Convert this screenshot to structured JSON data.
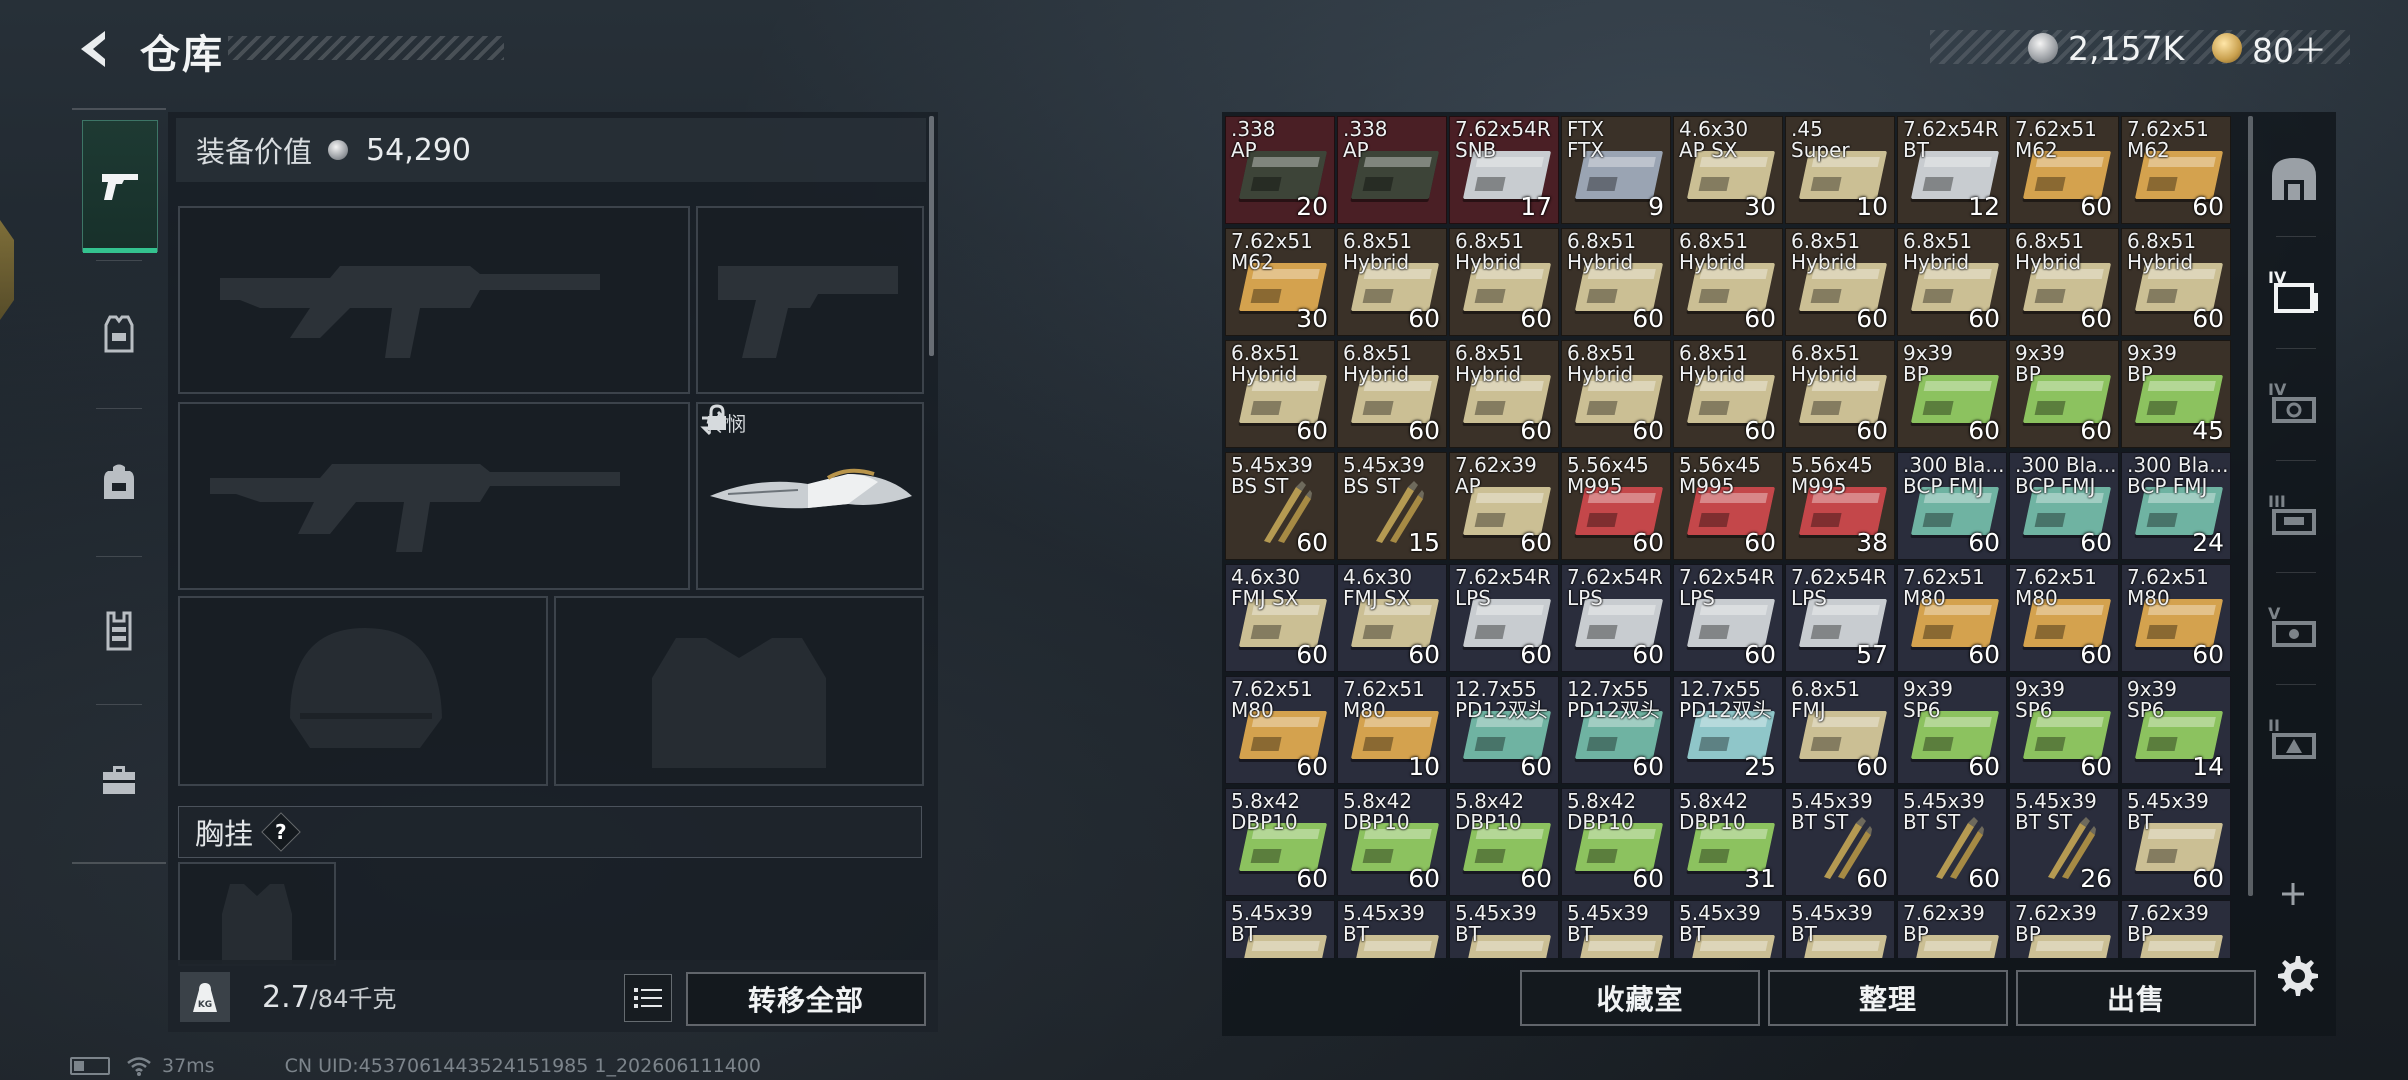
{
  "header": {
    "title": "仓库",
    "currency_silver": "2,157K",
    "currency_gold": "80＋"
  },
  "loadout": {
    "gear_value_label": "装备价值",
    "gear_value": "54,290",
    "melee_name": "怜悯",
    "chest_rig_label": "胸挂",
    "help_glyph": "?",
    "weight_value": "2.7",
    "weight_capacity": "/84千克",
    "transfer_all_label": "转移全部",
    "weight_icon_label": "KG"
  },
  "bottom_buttons": {
    "collection_room": "收藏室",
    "organize": "整理",
    "sell": "出售"
  },
  "status": {
    "ping": "37ms",
    "uid": "CN UID:4537061443524151985 1_202606111400"
  },
  "grid": {
    "rows": [
      [
        {
          "name": ".338\nAP",
          "count": "20",
          "bg": "#4a1f25",
          "box": "dark"
        },
        {
          "name": ".338\nAP",
          "count": "",
          "bg": "#4a1f25",
          "box": "dark"
        },
        {
          "name": "7.62x54R\nSNB",
          "count": "17",
          "bg": "#4a1f25",
          "box": "silver"
        },
        {
          "name": "FTX\nFTX",
          "count": "9",
          "bg": "#3a3128",
          "box": "steel"
        },
        {
          "name": "4.6x30\nAP SX",
          "count": "30",
          "bg": "#3a3128",
          "box": "beige"
        },
        {
          "name": ".45\nSuper",
          "count": "10",
          "bg": "#3a3128",
          "box": "beige"
        },
        {
          "name": "7.62x54R\nBT",
          "count": "12",
          "bg": "#3a3128",
          "box": "silver"
        },
        {
          "name": "7.62x51\nM62",
          "count": "60",
          "bg": "#3a3128",
          "box": "tan"
        },
        {
          "name": "7.62x51\nM62",
          "count": "60",
          "bg": "#3a3128",
          "box": "tan"
        }
      ],
      [
        {
          "name": "7.62x51\nM62",
          "count": "30",
          "bg": "#3a3128",
          "box": "tan"
        },
        {
          "name": "6.8x51\nHybrid",
          "count": "60",
          "bg": "#3a3128",
          "box": "beige"
        },
        {
          "name": "6.8x51\nHybrid",
          "count": "60",
          "bg": "#3a3128",
          "box": "beige"
        },
        {
          "name": "6.8x51\nHybrid",
          "count": "60",
          "bg": "#3a3128",
          "box": "beige"
        },
        {
          "name": "6.8x51\nHybrid",
          "count": "60",
          "bg": "#3a3128",
          "box": "beige"
        },
        {
          "name": "6.8x51\nHybrid",
          "count": "60",
          "bg": "#3a3128",
          "box": "beige"
        },
        {
          "name": "6.8x51\nHybrid",
          "count": "60",
          "bg": "#3a3128",
          "box": "beige"
        },
        {
          "name": "6.8x51\nHybrid",
          "count": "60",
          "bg": "#3a3128",
          "box": "beige"
        },
        {
          "name": "6.8x51\nHybrid",
          "count": "60",
          "bg": "#3a3128",
          "box": "beige"
        }
      ],
      [
        {
          "name": "6.8x51\nHybrid",
          "count": "60",
          "bg": "#3a3128",
          "box": "beige"
        },
        {
          "name": "6.8x51\nHybrid",
          "count": "60",
          "bg": "#3a3128",
          "box": "beige"
        },
        {
          "name": "6.8x51\nHybrid",
          "count": "60",
          "bg": "#3a3128",
          "box": "beige"
        },
        {
          "name": "6.8x51\nHybrid",
          "count": "60",
          "bg": "#3a3128",
          "box": "beige"
        },
        {
          "name": "6.8x51\nHybrid",
          "count": "60",
          "bg": "#3a3128",
          "box": "beige"
        },
        {
          "name": "6.8x51\nHybrid",
          "count": "60",
          "bg": "#3a3128",
          "box": "beige"
        },
        {
          "name": "9x39\nBP",
          "count": "60",
          "bg": "#3a3128",
          "box": "green"
        },
        {
          "name": "9x39\nBP",
          "count": "60",
          "bg": "#3a3128",
          "box": "green"
        },
        {
          "name": "9x39\nBP",
          "count": "45",
          "bg": "#3a3128",
          "box": "green"
        }
      ],
      [
        {
          "name": "5.45x39\nBS ST",
          "count": "60",
          "bg": "#3a3128",
          "box": "shells"
        },
        {
          "name": "5.45x39\nBS ST",
          "count": "15",
          "bg": "#3a3128",
          "box": "shells"
        },
        {
          "name": "7.62x39\nAP",
          "count": "60",
          "bg": "#3a3128",
          "box": "beige"
        },
        {
          "name": "5.56x45\nM995",
          "count": "60",
          "bg": "#3a3128",
          "box": "red"
        },
        {
          "name": "5.56x45\nM995",
          "count": "60",
          "bg": "#3a3128",
          "box": "red"
        },
        {
          "name": "5.56x45\nM995",
          "count": "38",
          "bg": "#3a3128",
          "box": "red"
        },
        {
          "name": ".300 Bla...\nBCP FMJ",
          "count": "60",
          "bg": "#2a2d3c",
          "box": "teal"
        },
        {
          "name": ".300 Bla...\nBCP FMJ",
          "count": "60",
          "bg": "#2a2d3c",
          "box": "teal"
        },
        {
          "name": ".300 Bla...\nBCP FMJ",
          "count": "24",
          "bg": "#2a2d3c",
          "box": "teal"
        }
      ],
      [
        {
          "name": "4.6x30\nFMJ SX",
          "count": "60",
          "bg": "#2a2d3c",
          "box": "beige"
        },
        {
          "name": "4.6x30\nFMJ SX",
          "count": "60",
          "bg": "#2a2d3c",
          "box": "beige"
        },
        {
          "name": "7.62x54R\nLPS",
          "count": "60",
          "bg": "#2a2d3c",
          "box": "silver"
        },
        {
          "name": "7.62x54R\nLPS",
          "count": "60",
          "bg": "#2a2d3c",
          "box": "silver"
        },
        {
          "name": "7.62x54R\nLPS",
          "count": "60",
          "bg": "#2a2d3c",
          "box": "silver"
        },
        {
          "name": "7.62x54R\nLPS",
          "count": "57",
          "bg": "#2a2d3c",
          "box": "silver"
        },
        {
          "name": "7.62x51\nM80",
          "count": "60",
          "bg": "#2a2d3c",
          "box": "tan"
        },
        {
          "name": "7.62x51\nM80",
          "count": "60",
          "bg": "#2a2d3c",
          "box": "tan"
        },
        {
          "name": "7.62x51\nM80",
          "count": "60",
          "bg": "#2a2d3c",
          "box": "tan"
        }
      ],
      [
        {
          "name": "7.62x51\nM80",
          "count": "60",
          "bg": "#2a2d3c",
          "box": "tan"
        },
        {
          "name": "7.62x51\nM80",
          "count": "10",
          "bg": "#2a2d3c",
          "box": "tan"
        },
        {
          "name": "12.7x55\nPD12双头",
          "count": "60",
          "bg": "#2a2d3c",
          "box": "teal"
        },
        {
          "name": "12.7x55\nPD12双头",
          "count": "60",
          "bg": "#2a2d3c",
          "box": "teal"
        },
        {
          "name": "12.7x55\nPD12双头",
          "count": "25",
          "bg": "#2a2d3c",
          "box": "lightteal"
        },
        {
          "name": "6.8x51\nFMJ",
          "count": "60",
          "bg": "#2a2d3c",
          "box": "beige"
        },
        {
          "name": "9x39\nSP6",
          "count": "60",
          "bg": "#2a2d3c",
          "box": "green"
        },
        {
          "name": "9x39\nSP6",
          "count": "60",
          "bg": "#2a2d3c",
          "box": "green"
        },
        {
          "name": "9x39\nSP6",
          "count": "14",
          "bg": "#2a2d3c",
          "box": "green"
        }
      ],
      [
        {
          "name": "5.8x42\nDBP10",
          "count": "60",
          "bg": "#2a2d3c",
          "box": "green"
        },
        {
          "name": "5.8x42\nDBP10",
          "count": "60",
          "bg": "#2a2d3c",
          "box": "green"
        },
        {
          "name": "5.8x42\nDBP10",
          "count": "60",
          "bg": "#2a2d3c",
          "box": "green"
        },
        {
          "name": "5.8x42\nDBP10",
          "count": "60",
          "bg": "#2a2d3c",
          "box": "green"
        },
        {
          "name": "5.8x42\nDBP10",
          "count": "31",
          "bg": "#2a2d3c",
          "box": "green"
        },
        {
          "name": "5.45x39\nBT ST",
          "count": "60",
          "bg": "#2a2d3c",
          "box": "shells"
        },
        {
          "name": "5.45x39\nBT ST",
          "count": "60",
          "bg": "#2a2d3c",
          "box": "shells"
        },
        {
          "name": "5.45x39\nBT ST",
          "count": "26",
          "bg": "#2a2d3c",
          "box": "shells"
        },
        {
          "name": "5.45x39\nBT",
          "count": "60",
          "bg": "#2a2d3c",
          "box": "beige"
        }
      ],
      [
        {
          "name": "5.45x39\nBT",
          "count": "",
          "bg": "#2a2d3c",
          "box": "beige"
        },
        {
          "name": "5.45x39\nBT",
          "count": "",
          "bg": "#2a2d3c",
          "box": "beige"
        },
        {
          "name": "5.45x39\nBT",
          "count": "",
          "bg": "#2a2d3c",
          "box": "beige"
        },
        {
          "name": "5.45x39\nBT",
          "count": "",
          "bg": "#2a2d3c",
          "box": "beige"
        },
        {
          "name": "5.45x39\nBT",
          "count": "",
          "bg": "#2a2d3c",
          "box": "beige"
        },
        {
          "name": "5.45x39\nBT",
          "count": "",
          "bg": "#2a2d3c",
          "box": "beige"
        },
        {
          "name": "7.62x39\nBP",
          "count": "",
          "bg": "#2a2d3c",
          "box": "beige"
        },
        {
          "name": "7.62x39\nBP",
          "count": "",
          "bg": "#2a2d3c",
          "box": "beige"
        },
        {
          "name": "7.62x39\nBP",
          "count": "",
          "bg": "#2a2d3c",
          "box": "beige"
        }
      ]
    ]
  },
  "colors": {
    "accent_green": "#34c38f",
    "box_dark": "#3d4438",
    "box_silver": "#c8ccd0",
    "box_steel": "#9aa4b3",
    "box_beige": "#cbbf94",
    "box_tan": "#d4a24e",
    "box_green": "#8cc25f",
    "box_red": "#c4474a",
    "box_teal": "#6fb3a2",
    "box_lightteal": "#8fc6c9"
  },
  "icons": {
    "left_tabs": [
      "pistol-icon",
      "armor-vest-icon",
      "backpack-icon",
      "chest-rig-icon",
      "toolbox-icon"
    ],
    "right_tabs": [
      "vault-icon",
      "storage-iv-icon",
      "storage-iv-b-icon",
      "storage-iii-icon",
      "storage-v-icon",
      "storage-ii-icon"
    ]
  }
}
